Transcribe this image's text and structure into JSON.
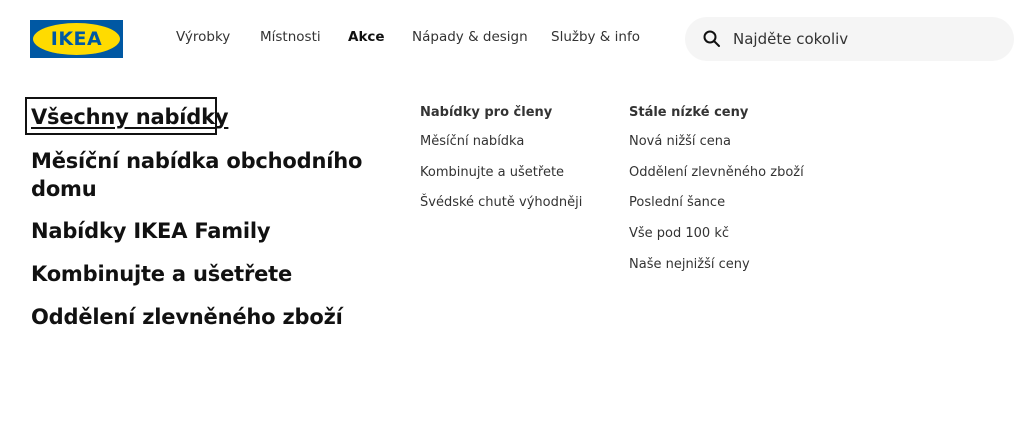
{
  "logo": {
    "text": "IKEA"
  },
  "nav": {
    "items": [
      {
        "label": "Výrobky",
        "active": false
      },
      {
        "label": "Místnosti",
        "active": false
      },
      {
        "label": "Akce",
        "active": true
      },
      {
        "label": "Nápady & design",
        "active": false
      },
      {
        "label": "Služby & info",
        "active": false
      }
    ]
  },
  "search": {
    "placeholder": "Najděte cokoliv",
    "icon": "search-icon"
  },
  "menu": {
    "main_links": [
      "Všechny nabídky",
      "Měsíční nabídka obchodního",
      "domu",
      "Nabídky IKEA Family",
      "Kombinujte a ušetřete",
      "Oddělení zlevněného zboží"
    ],
    "members": {
      "title": "Nabídky pro členy",
      "links": [
        "Měsíční nabídka",
        "Kombinujte a ušetřete",
        "Švédské chutě výhodněji"
      ]
    },
    "low_prices": {
      "title": "Stále nízké ceny",
      "links": [
        "Nová nižší cena",
        "Oddělení zlevněného zboží",
        "Poslední šance",
        "Vše pod 100 kč",
        "Naše nejnižší ceny"
      ]
    }
  },
  "colors": {
    "brand_blue": "#0058a3",
    "brand_yellow": "#ffdb00",
    "search_bg": "#f5f5f5"
  }
}
